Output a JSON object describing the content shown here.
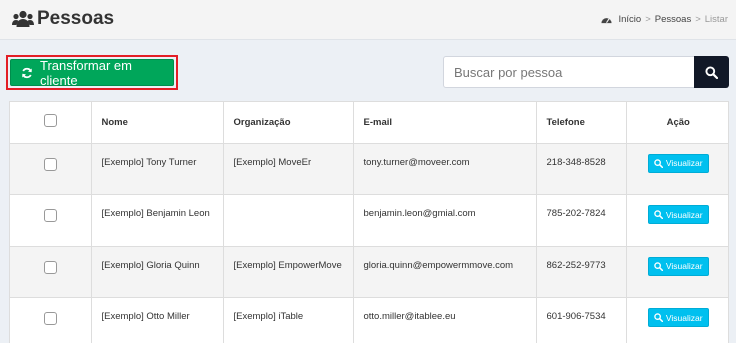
{
  "header": {
    "title": "Pessoas",
    "title_icon": "users-icon",
    "breadcrumb": {
      "icon": "dashboard-icon",
      "items": [
        "Início",
        "Pessoas",
        "Listar"
      ],
      "separator": ">"
    }
  },
  "toolbar": {
    "convert_label": "Transformar em cliente",
    "convert_icon": "refresh-icon",
    "search_placeholder": "Buscar por pessoa",
    "search_icon": "search-icon"
  },
  "table": {
    "headers": [
      "Nome",
      "Organização",
      "E-mail",
      "Telefone",
      "Ação"
    ],
    "rows": [
      {
        "nome": "[Exemplo] Tony Turner",
        "organizacao": "[Exemplo] MoveEr",
        "email": "tony.turner@moveer.com",
        "telefone": "218-348-8528",
        "acao": "Visualizar"
      },
      {
        "nome": "[Exemplo] Benjamin Leon",
        "organizacao": "",
        "email": "benjamin.leon@gmial.com",
        "telefone": "785-202-7824",
        "acao": "Visualizar"
      },
      {
        "nome": "[Exemplo] Gloria Quinn",
        "organizacao": "[Exemplo] EmpowerMove",
        "email": "gloria.quinn@empowermmove.com",
        "telefone": "862-252-9773",
        "acao": "Visualizar"
      },
      {
        "nome": "[Exemplo] Otto Miller",
        "organizacao": "[Exemplo] iTable",
        "email": "otto.miller@itablee.eu",
        "telefone": "601-906-7534",
        "acao": "Visualizar"
      }
    ]
  },
  "colors": {
    "success": "#00a65a",
    "info": "#00c0ef",
    "highlight_border": "#e31d25",
    "search_button": "#111827"
  }
}
